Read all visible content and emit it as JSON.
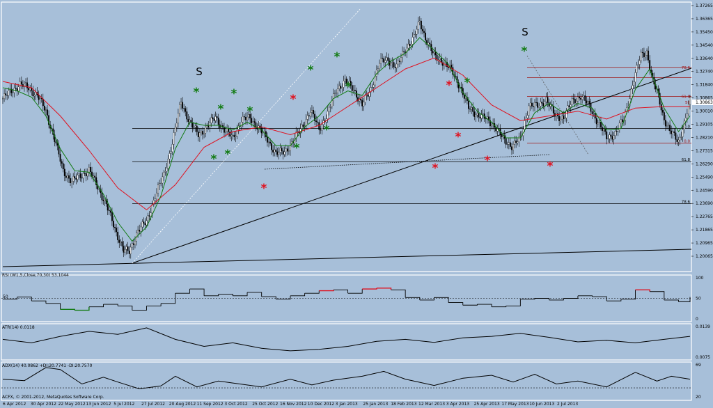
{
  "colors": {
    "background": "#a7bfd9",
    "ema_fast": "#117a11",
    "ema_slow": "#e0101e",
    "candle": "#000000",
    "rsi_high": "#e0101e",
    "rsi_low": "#117a11",
    "trendline": "#000000",
    "fib": "#a01010"
  },
  "chart_data": [
    {
      "type": "candlestick",
      "panel": "price",
      "y_ticks": [
        "1.37265",
        "1.36365",
        "1.35450",
        "1.34540",
        "1.33640",
        "1.32740",
        "1.31840",
        "1.30865",
        "1.30010",
        "1.29105",
        "1.28210",
        "1.27315",
        "1.26290",
        "1.25490",
        "1.24590",
        "1.23690",
        "1.22765",
        "1.21865",
        "1.20965",
        "1.20065"
      ],
      "current_price": "1.30863",
      "ylim": [
        1.2006,
        1.3727
      ],
      "x_ticks": [
        "6 Apr 2012",
        "30 Apr 2012",
        "22 May 2012",
        "13 Jun 2012",
        "5 Jul 2012",
        "27 Jul 2012",
        "20 Aug 2012",
        "11 Sep 2012",
        "3 Oct 2012",
        "25 Oct 2012",
        "16 Nov 2012",
        "10 Dec 2012",
        "3 Jan 2013",
        "25 Jan 2013",
        "18 Feb 2013",
        "12 Mar 2013",
        "3 Apr 2013",
        "25 Apr 2013",
        "17 May 2013",
        "10 Jun 2013",
        "2 Jul 2013"
      ],
      "close_path": [
        [
          0,
          1.311
        ],
        [
          6,
          1.316
        ],
        [
          12,
          1.32
        ],
        [
          18,
          1.318
        ],
        [
          24,
          1.313
        ],
        [
          30,
          1.303
        ],
        [
          36,
          1.285
        ],
        [
          42,
          1.265
        ],
        [
          48,
          1.258
        ],
        [
          54,
          1.262
        ],
        [
          60,
          1.265
        ],
        [
          66,
          1.255
        ],
        [
          72,
          1.243
        ],
        [
          78,
          1.228
        ],
        [
          84,
          1.214
        ],
        [
          88,
          1.213
        ],
        [
          94,
          1.227
        ],
        [
          100,
          1.232
        ],
        [
          106,
          1.249
        ],
        [
          112,
          1.262
        ],
        [
          118,
          1.283
        ],
        [
          124,
          1.309
        ],
        [
          130,
          1.296
        ],
        [
          136,
          1.288
        ],
        [
          142,
          1.293
        ],
        [
          148,
          1.299
        ],
        [
          154,
          1.291
        ],
        [
          160,
          1.286
        ],
        [
          166,
          1.297
        ],
        [
          172,
          1.299
        ],
        [
          178,
          1.292
        ],
        [
          184,
          1.285
        ],
        [
          190,
          1.276
        ],
        [
          196,
          1.277
        ],
        [
          202,
          1.284
        ],
        [
          208,
          1.293
        ],
        [
          214,
          1.303
        ],
        [
          220,
          1.292
        ],
        [
          226,
          1.301
        ],
        [
          232,
          1.317
        ],
        [
          238,
          1.322
        ],
        [
          244,
          1.317
        ],
        [
          250,
          1.307
        ],
        [
          256,
          1.317
        ],
        [
          262,
          1.334
        ],
        [
          268,
          1.336
        ],
        [
          274,
          1.331
        ],
        [
          280,
          1.343
        ],
        [
          286,
          1.35
        ],
        [
          290,
          1.36
        ],
        [
          294,
          1.35
        ],
        [
          300,
          1.338
        ],
        [
          306,
          1.335
        ],
        [
          312,
          1.329
        ],
        [
          318,
          1.319
        ],
        [
          324,
          1.305
        ],
        [
          330,
          1.301
        ],
        [
          336,
          1.298
        ],
        [
          342,
          1.294
        ],
        [
          348,
          1.285
        ],
        [
          354,
          1.281
        ],
        [
          360,
          1.285
        ],
        [
          366,
          1.307
        ],
        [
          372,
          1.306
        ],
        [
          378,
          1.311
        ],
        [
          384,
          1.3
        ],
        [
          390,
          1.299
        ],
        [
          396,
          1.309
        ],
        [
          402,
          1.313
        ],
        [
          408,
          1.306
        ],
        [
          414,
          1.296
        ],
        [
          420,
          1.286
        ],
        [
          426,
          1.289
        ],
        [
          432,
          1.298
        ],
        [
          438,
          1.32
        ],
        [
          444,
          1.339
        ],
        [
          448,
          1.341
        ],
        [
          452,
          1.322
        ],
        [
          456,
          1.313
        ],
        [
          460,
          1.298
        ],
        [
          464,
          1.29
        ],
        [
          470,
          1.284
        ],
        [
          474,
          1.295
        ],
        [
          478,
          1.309
        ]
      ],
      "ema_fast": [
        [
          0,
          1.318
        ],
        [
          10,
          1.316
        ],
        [
          20,
          1.312
        ],
        [
          30,
          1.3
        ],
        [
          40,
          1.279
        ],
        [
          50,
          1.265
        ],
        [
          60,
          1.264
        ],
        [
          70,
          1.25
        ],
        [
          80,
          1.232
        ],
        [
          90,
          1.22
        ],
        [
          100,
          1.229
        ],
        [
          110,
          1.249
        ],
        [
          120,
          1.279
        ],
        [
          130,
          1.296
        ],
        [
          140,
          1.294
        ],
        [
          150,
          1.294
        ],
        [
          160,
          1.291
        ],
        [
          170,
          1.296
        ],
        [
          180,
          1.291
        ],
        [
          190,
          1.281
        ],
        [
          200,
          1.281
        ],
        [
          210,
          1.293
        ],
        [
          220,
          1.3
        ],
        [
          230,
          1.311
        ],
        [
          240,
          1.316
        ],
        [
          250,
          1.313
        ],
        [
          260,
          1.327
        ],
        [
          270,
          1.335
        ],
        [
          280,
          1.34
        ],
        [
          290,
          1.35
        ],
        [
          300,
          1.342
        ],
        [
          310,
          1.333
        ],
        [
          320,
          1.315
        ],
        [
          330,
          1.303
        ],
        [
          340,
          1.296
        ],
        [
          350,
          1.286
        ],
        [
          360,
          1.286
        ],
        [
          370,
          1.302
        ],
        [
          380,
          1.308
        ],
        [
          390,
          1.302
        ],
        [
          400,
          1.308
        ],
        [
          410,
          1.305
        ],
        [
          420,
          1.291
        ],
        [
          430,
          1.292
        ],
        [
          440,
          1.317
        ],
        [
          450,
          1.33
        ],
        [
          460,
          1.305
        ],
        [
          470,
          1.29
        ],
        [
          478,
          1.3
        ]
      ],
      "ema_slow": [
        [
          0,
          1.322
        ],
        [
          20,
          1.318
        ],
        [
          40,
          1.3
        ],
        [
          60,
          1.278
        ],
        [
          80,
          1.254
        ],
        [
          100,
          1.24
        ],
        [
          120,
          1.256
        ],
        [
          140,
          1.28
        ],
        [
          160,
          1.29
        ],
        [
          180,
          1.293
        ],
        [
          200,
          1.288
        ],
        [
          220,
          1.294
        ],
        [
          240,
          1.306
        ],
        [
          260,
          1.318
        ],
        [
          280,
          1.33
        ],
        [
          300,
          1.337
        ],
        [
          320,
          1.326
        ],
        [
          340,
          1.307
        ],
        [
          360,
          1.297
        ],
        [
          380,
          1.3
        ],
        [
          400,
          1.303
        ],
        [
          420,
          1.298
        ],
        [
          440,
          1.305
        ],
        [
          460,
          1.306
        ],
        [
          478,
          1.306
        ]
      ],
      "hlines": [
        1.292,
        1.2708,
        1.244,
        1.2827,
        1.331
      ],
      "fib_labels": [
        "78.6",
        "61.8",
        "50",
        "50.0",
        "0.0",
        "61.8",
        "78.6"
      ],
      "pattern_labels": [
        "S",
        "S"
      ],
      "star_symbol": "*"
    },
    {
      "type": "line",
      "panel": "rsi",
      "legend": "RSI (W1,5,Close,70,30) 53.1044",
      "y_ticks": [
        "100",
        "50",
        "0"
      ],
      "level_label": "50",
      "ylim": [
        0,
        100
      ],
      "values": [
        [
          0,
          48
        ],
        [
          10,
          53
        ],
        [
          20,
          44
        ],
        [
          30,
          38
        ],
        [
          40,
          24
        ],
        [
          50,
          22
        ],
        [
          60,
          30
        ],
        [
          70,
          36
        ],
        [
          80,
          32
        ],
        [
          90,
          22
        ],
        [
          100,
          32
        ],
        [
          110,
          38
        ],
        [
          120,
          62
        ],
        [
          130,
          72
        ],
        [
          140,
          56
        ],
        [
          150,
          60
        ],
        [
          160,
          56
        ],
        [
          170,
          64
        ],
        [
          180,
          54
        ],
        [
          190,
          48
        ],
        [
          200,
          56
        ],
        [
          210,
          62
        ],
        [
          220,
          68
        ],
        [
          230,
          70
        ],
        [
          240,
          62
        ],
        [
          250,
          72
        ],
        [
          260,
          74
        ],
        [
          270,
          70
        ],
        [
          280,
          52
        ],
        [
          290,
          46
        ],
        [
          300,
          52
        ],
        [
          310,
          40
        ],
        [
          320,
          34
        ],
        [
          330,
          36
        ],
        [
          340,
          30
        ],
        [
          350,
          32
        ],
        [
          360,
          48
        ],
        [
          370,
          50
        ],
        [
          380,
          46
        ],
        [
          390,
          50
        ],
        [
          400,
          56
        ],
        [
          410,
          54
        ],
        [
          420,
          44
        ],
        [
          430,
          48
        ],
        [
          440,
          70
        ],
        [
          450,
          66
        ],
        [
          460,
          46
        ],
        [
          470,
          42
        ],
        [
          478,
          53
        ]
      ]
    },
    {
      "type": "line",
      "panel": "atr",
      "legend": "ATR(14) 0.0118",
      "y_ticks": [
        "0.0139",
        "0.0075"
      ],
      "ylim": [
        0.0075,
        0.0139
      ],
      "values": [
        [
          0,
          0.0112
        ],
        [
          20,
          0.0105
        ],
        [
          40,
          0.0118
        ],
        [
          60,
          0.0128
        ],
        [
          80,
          0.0122
        ],
        [
          100,
          0.0135
        ],
        [
          120,
          0.0112
        ],
        [
          140,
          0.0098
        ],
        [
          160,
          0.0105
        ],
        [
          180,
          0.0094
        ],
        [
          200,
          0.0089
        ],
        [
          220,
          0.0092
        ],
        [
          240,
          0.0098
        ],
        [
          260,
          0.0108
        ],
        [
          280,
          0.0112
        ],
        [
          300,
          0.0106
        ],
        [
          320,
          0.0115
        ],
        [
          340,
          0.0118
        ],
        [
          360,
          0.0124
        ],
        [
          380,
          0.0116
        ],
        [
          400,
          0.0107
        ],
        [
          420,
          0.011
        ],
        [
          440,
          0.0105
        ],
        [
          460,
          0.0112
        ],
        [
          478,
          0.0118
        ]
      ]
    },
    {
      "type": "line",
      "panel": "adx",
      "legend": "ADX(14) 40.0862 +DI:20.7741 -DI:20.7570",
      "y_ticks": [
        "69",
        "20"
      ],
      "ylim": [
        0,
        69
      ],
      "values": [
        [
          0,
          38
        ],
        [
          15,
          35
        ],
        [
          30,
          62
        ],
        [
          40,
          58
        ],
        [
          55,
          28
        ],
        [
          70,
          42
        ],
        [
          80,
          32
        ],
        [
          95,
          18
        ],
        [
          110,
          24
        ],
        [
          120,
          44
        ],
        [
          135,
          22
        ],
        [
          150,
          34
        ],
        [
          160,
          30
        ],
        [
          180,
          22
        ],
        [
          200,
          38
        ],
        [
          215,
          26
        ],
        [
          230,
          36
        ],
        [
          250,
          44
        ],
        [
          265,
          54
        ],
        [
          280,
          38
        ],
        [
          300,
          25
        ],
        [
          320,
          40
        ],
        [
          340,
          46
        ],
        [
          355,
          32
        ],
        [
          370,
          48
        ],
        [
          385,
          28
        ],
        [
          400,
          34
        ],
        [
          420,
          22
        ],
        [
          440,
          52
        ],
        [
          455,
          34
        ],
        [
          465,
          44
        ],
        [
          478,
          38
        ]
      ]
    }
  ],
  "footer": {
    "copyright": "ACFX, © 2001-2012, MetaQuotes Software Corp."
  }
}
